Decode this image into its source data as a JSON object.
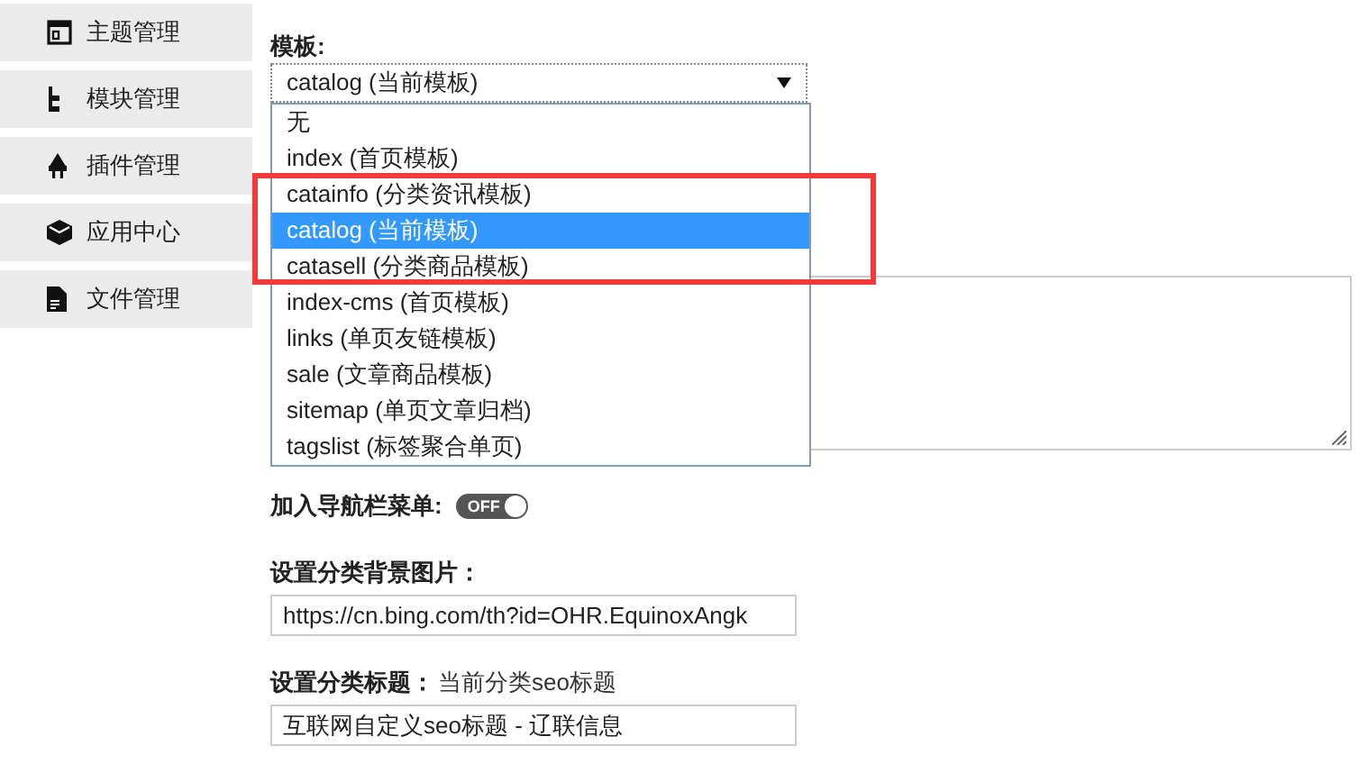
{
  "sidebar": {
    "items": [
      {
        "label": "主题管理"
      },
      {
        "label": "模块管理"
      },
      {
        "label": "插件管理"
      },
      {
        "label": "应用中心"
      },
      {
        "label": "文件管理"
      }
    ]
  },
  "template": {
    "label": "模板:",
    "value": "catalog (当前模板)",
    "expanded": true,
    "options": [
      {
        "label": "无",
        "selected": false,
        "boxed": false
      },
      {
        "label": "index (首页模板)",
        "selected": false,
        "boxed": false
      },
      {
        "label": "catainfo (分类资讯模板)",
        "selected": false,
        "boxed": true
      },
      {
        "label": "catalog (当前模板)",
        "selected": true,
        "boxed": true
      },
      {
        "label": "catasell (分类商品模板)",
        "selected": false,
        "boxed": true
      },
      {
        "label": "index-cms (首页模板)",
        "selected": false,
        "boxed": false
      },
      {
        "label": "links (单页友链模板)",
        "selected": false,
        "boxed": false
      },
      {
        "label": "sale (文章商品模板)",
        "selected": false,
        "boxed": false
      },
      {
        "label": "sitemap (单页文章归档)",
        "selected": false,
        "boxed": false
      },
      {
        "label": "tagslist (标签聚合单页)",
        "selected": false,
        "boxed": false
      }
    ]
  },
  "nav_menu": {
    "label": "加入导航栏菜单:",
    "toggle": {
      "on": false,
      "text": "OFF"
    }
  },
  "background_image": {
    "label": "设置分类背景图片：",
    "value": "https://cn.bing.com/th?id=OHR.EquinoxAngk"
  },
  "seo_title": {
    "label": "设置分类标题：",
    "hint": "当前分类seo标题",
    "value": "互联网自定义seo标题 - 辽联信息"
  }
}
